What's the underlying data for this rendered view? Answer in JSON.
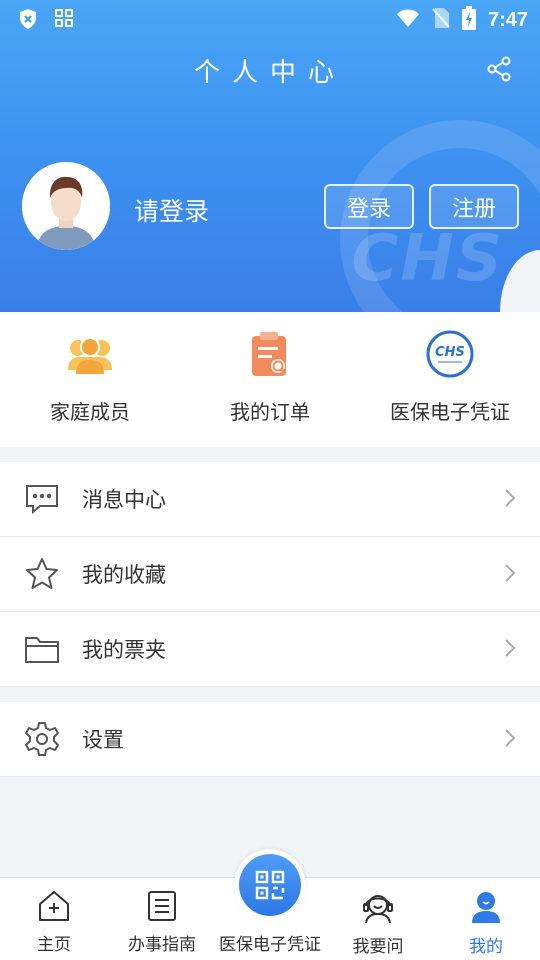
{
  "status_bar": {
    "time": "7:47"
  },
  "header": {
    "title": "个人中心",
    "login_prompt": "请登录",
    "login_button": "登录",
    "register_button": "注册",
    "watermark": "CHS"
  },
  "quick_actions": [
    {
      "label": "家庭成员",
      "icon": "family-members-icon"
    },
    {
      "label": "我的订单",
      "icon": "orders-icon"
    },
    {
      "label": "医保电子凭证",
      "icon": "chs-logo-icon"
    }
  ],
  "menu": [
    {
      "label": "消息中心",
      "icon": "message-icon"
    },
    {
      "label": "我的收藏",
      "icon": "star-icon"
    },
    {
      "label": "我的票夹",
      "icon": "folder-icon"
    }
  ],
  "settings": {
    "label": "设置",
    "icon": "gear-icon"
  },
  "tabs": [
    {
      "label": "主页",
      "icon": "home-icon"
    },
    {
      "label": "办事指南",
      "icon": "guide-icon"
    },
    {
      "label": "医保电子凭证",
      "icon": "qr-code-icon"
    },
    {
      "label": "我要问",
      "icon": "customer-service-icon"
    },
    {
      "label": "我的",
      "icon": "user-icon",
      "active": true
    }
  ],
  "colors": {
    "accent": "#2f7be6",
    "header_top": "#4aa6f6",
    "header_bottom": "#3a7fe8"
  }
}
